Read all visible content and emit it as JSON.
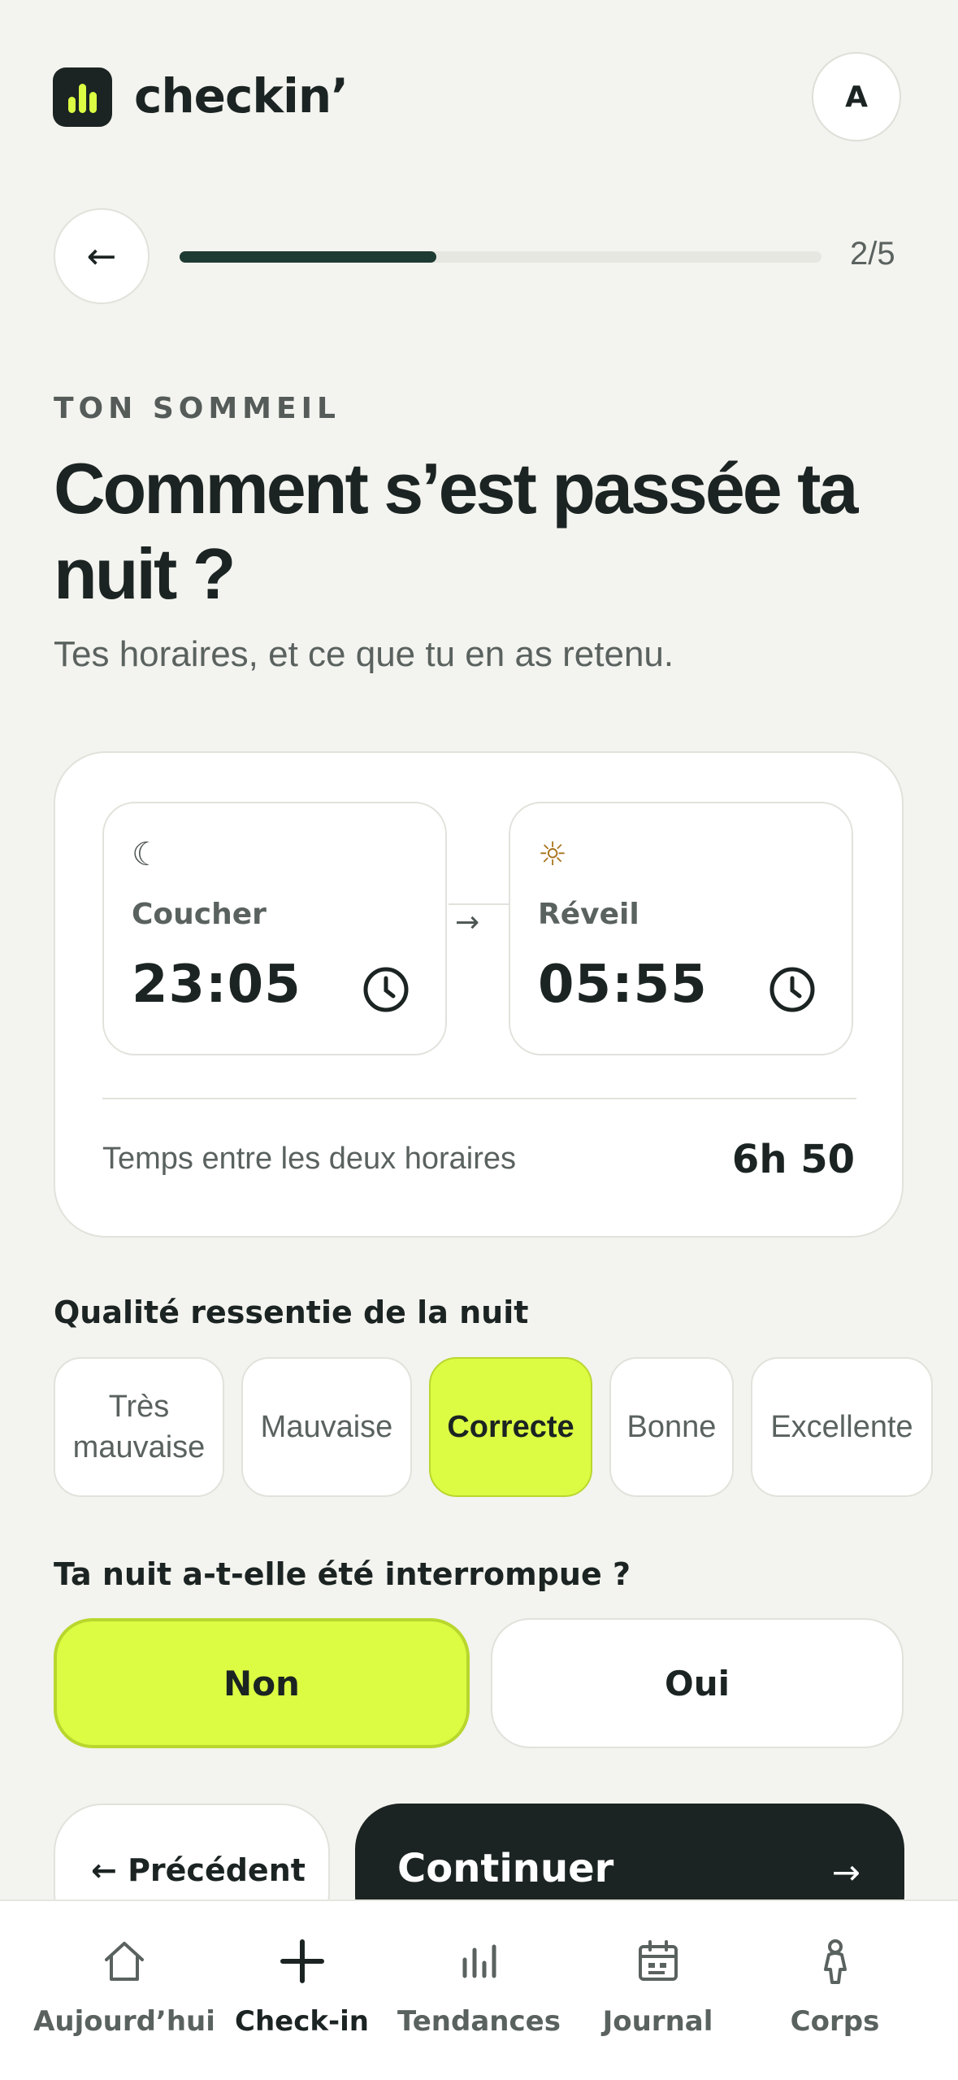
{
  "app": {
    "name": "checkin’",
    "avatar_initial": "A"
  },
  "progress": {
    "label": "2/5",
    "current": 2,
    "total": 5,
    "fraction": 0.4
  },
  "header": {
    "eyebrow": "TON SOMMEIL",
    "title": "Comment s’est passée ta nuit ?",
    "subtitle": "Tes horaires, et ce que tu en as retenu."
  },
  "times": {
    "bedtime": {
      "label": "Coucher",
      "value": "23:05",
      "icon": "moon-icon"
    },
    "arrow": "→",
    "wake": {
      "label": "Réveil",
      "value": "05:55",
      "icon": "sun-icon"
    },
    "duration_label": "Temps entre les deux horaires",
    "duration_value": "6h 50"
  },
  "quality": {
    "title": "Qualité ressentie de la nuit",
    "options": [
      "Très mauvaise",
      "Mauvaise",
      "Correcte",
      "Bonne",
      "Excellente"
    ],
    "selected": "Correcte"
  },
  "interrupted": {
    "title": "Ta nuit a-t-elle été interrompue ?",
    "options": [
      "Non",
      "Oui"
    ],
    "selected": "Non"
  },
  "actions": {
    "previous": "← Précédent",
    "continue": "Continuer",
    "continue_arrow": "→",
    "back_arrow": "←"
  },
  "nav": {
    "items": [
      "Aujourd’hui",
      "Check-in",
      "Tendances",
      "Journal",
      "Corps"
    ],
    "active": "Check-in"
  },
  "colors": {
    "accent": "#dcfc43",
    "dark": "#1b2422",
    "progress": "#1e3b33",
    "background": "#f3f3ef"
  }
}
